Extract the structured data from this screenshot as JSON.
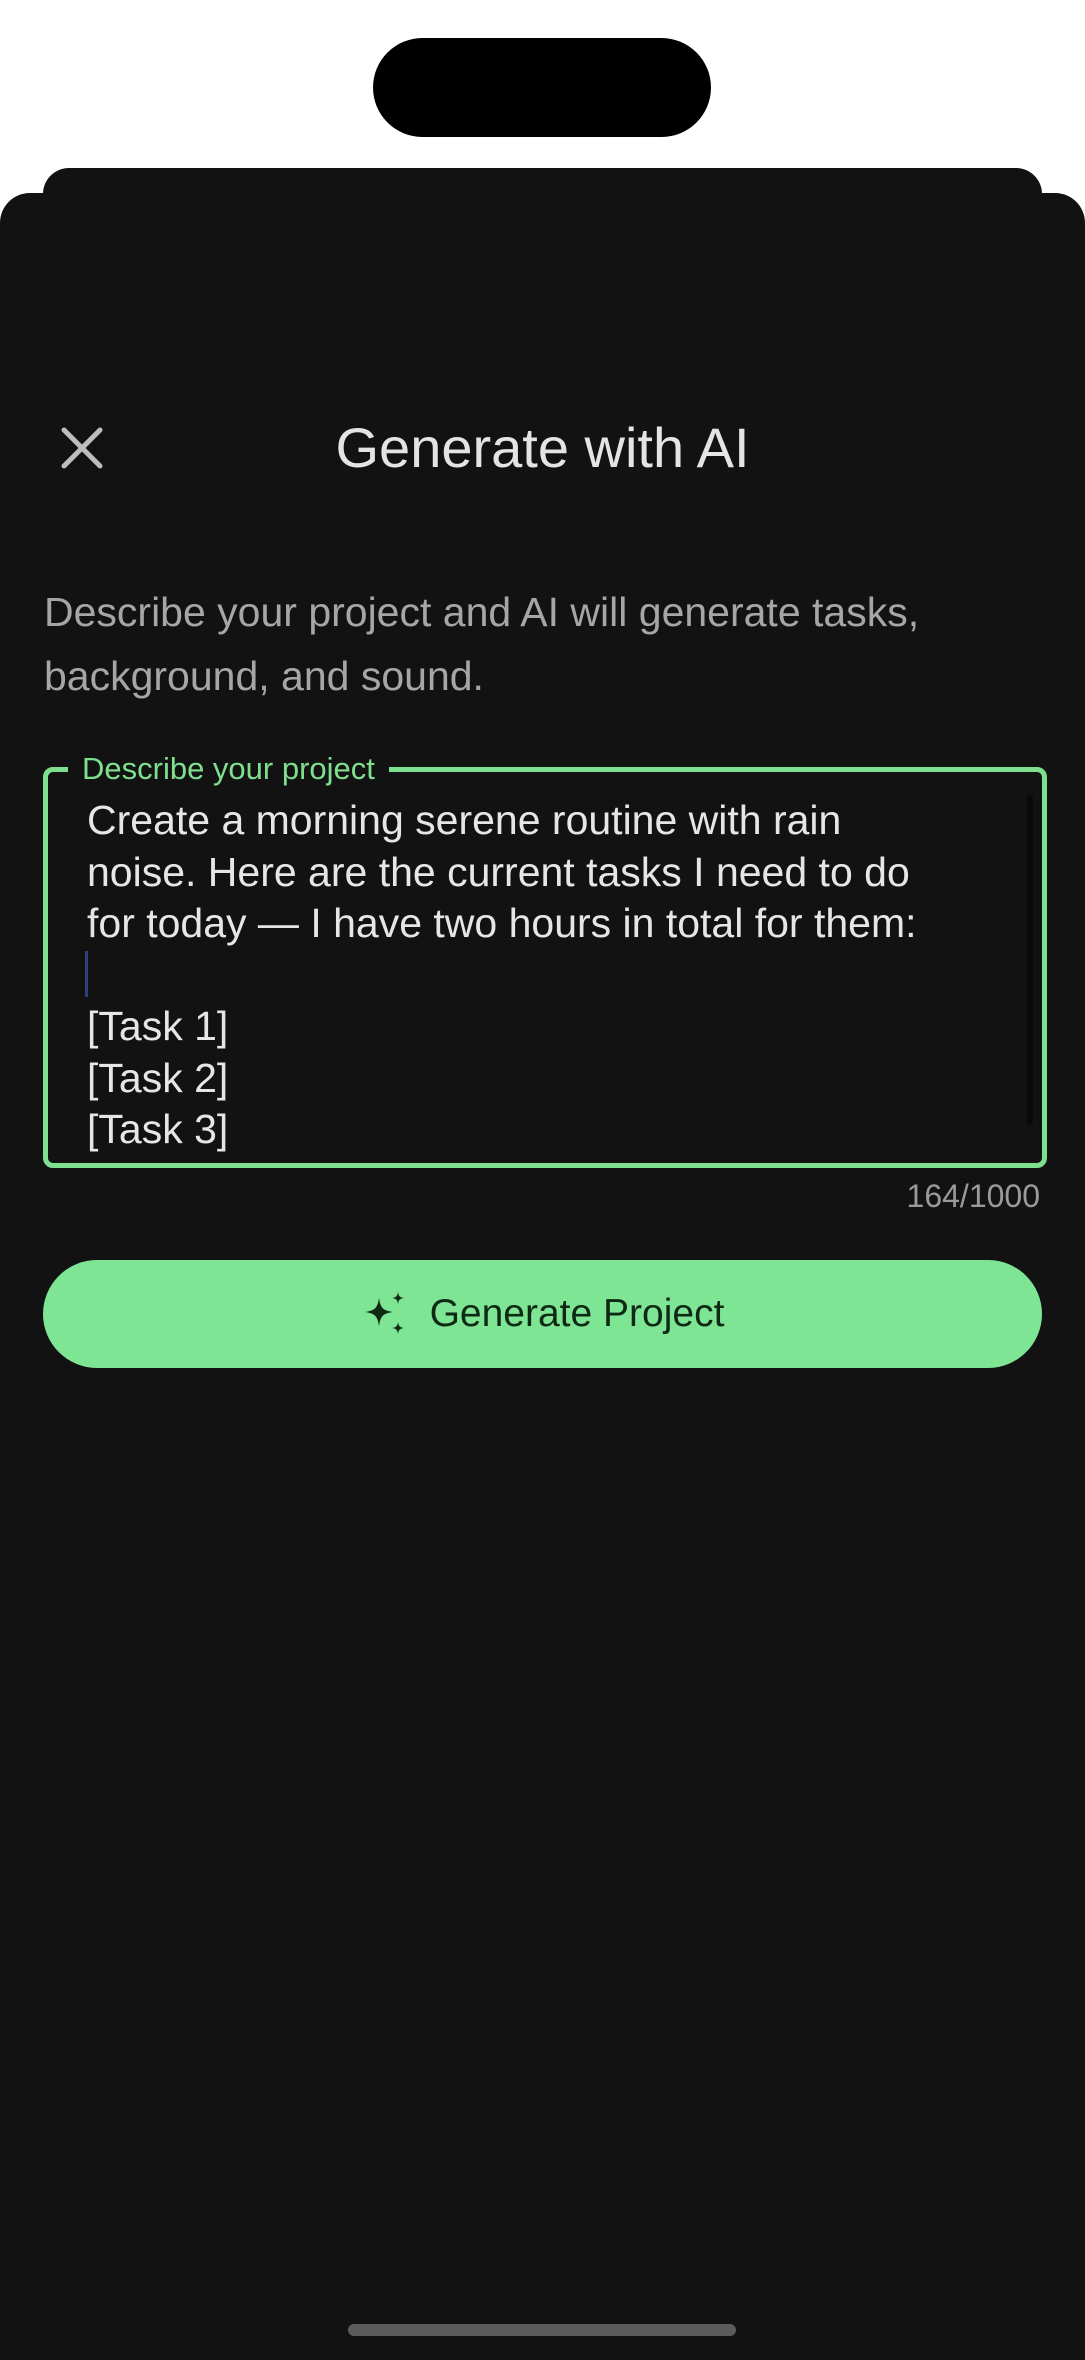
{
  "header": {
    "title": "Generate with AI",
    "close_icon": "close-icon"
  },
  "intro": {
    "description": "Describe your project and AI will generate tasks, background, and sound."
  },
  "prompt_field": {
    "label": "Describe your project",
    "value": "Create a morning serene routine with rain\nnoise. Here are the current tasks I need to do\nfor today — I have two hours in total for them:\n\n[Task 1]\n[Task 2]\n[Task 3]",
    "char_count": "164/1000"
  },
  "actions": {
    "generate_label": "Generate Project",
    "generate_icon": "sparkles-icon"
  },
  "colors": {
    "accent": "#7ee08f",
    "button_fill": "#7ee595",
    "background": "#121212"
  }
}
